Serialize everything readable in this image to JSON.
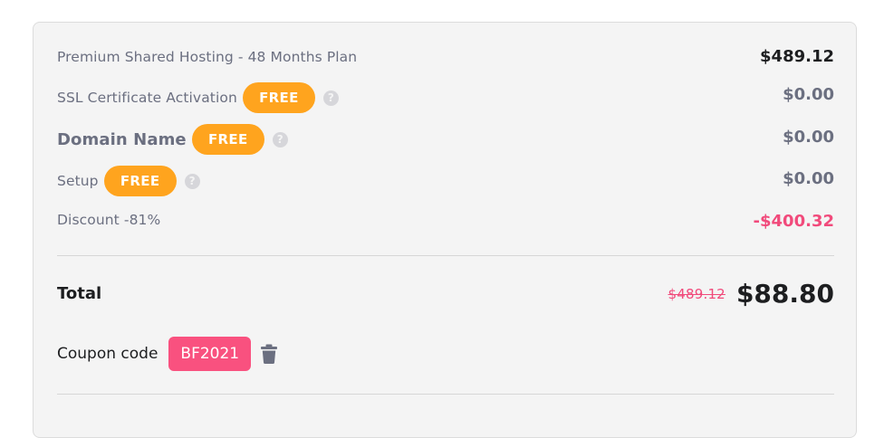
{
  "items": [
    {
      "label": "Premium Shared Hosting - 48 Months Plan",
      "amount": "$489.12"
    },
    {
      "label": "SSL Certificate Activation",
      "badge": "FREE",
      "help": "?",
      "amount": "$0.00"
    },
    {
      "label": "Domain Name",
      "badge": "FREE",
      "help": "?",
      "amount": "$0.00"
    },
    {
      "label": "Setup",
      "badge": "FREE",
      "help": "?",
      "amount": "$0.00"
    },
    {
      "label": "Discount -81%",
      "amount": "-$400.32"
    }
  ],
  "total": {
    "label": "Total",
    "old_price": "$489.12",
    "price": "$88.80"
  },
  "coupon": {
    "label": "Coupon code",
    "code": "BF2021",
    "remove_icon": "trash-icon"
  },
  "colors": {
    "free_badge": "#ffa41e",
    "coupon_badge": "#f9517f",
    "discount": "#f14a7b",
    "muted_text": "#6b6f80",
    "dark_text": "#1d1e20"
  }
}
